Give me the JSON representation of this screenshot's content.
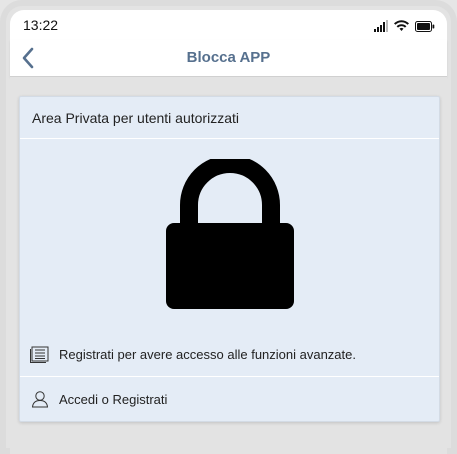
{
  "status_bar": {
    "time": "13:22"
  },
  "nav": {
    "title": "Blocca APP"
  },
  "card": {
    "header": "Area Privata per utenti autorizzati",
    "info_text": "Registrati per avere accesso alle funzioni avanzate.",
    "login_text": "Accedi o Registrati"
  },
  "colors": {
    "nav_title": "#56708e",
    "card_bg": "#e4ecf6",
    "lock": "#000000"
  }
}
